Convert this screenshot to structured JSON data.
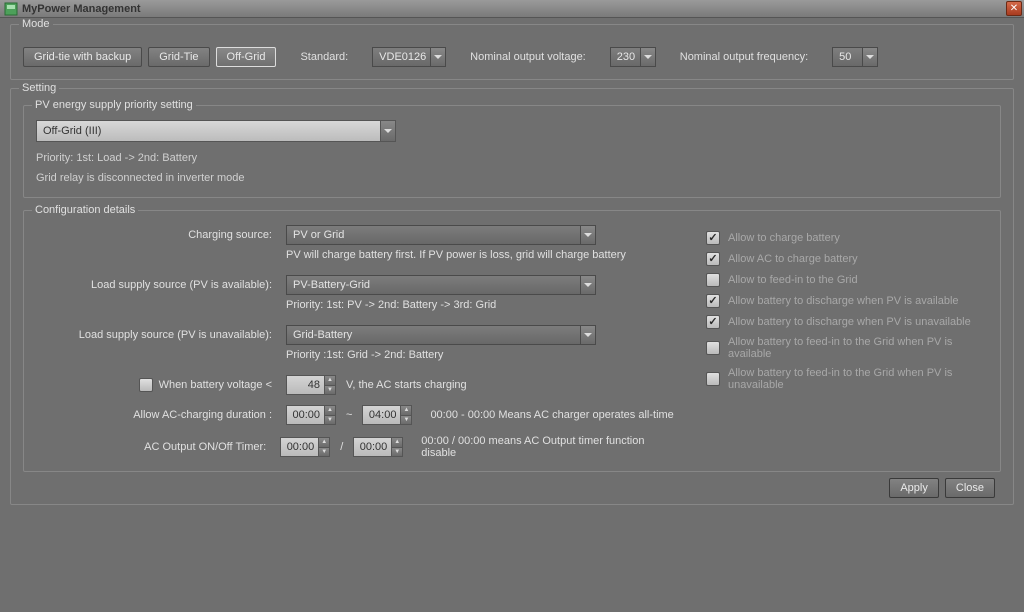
{
  "window": {
    "title": "MyPower Management"
  },
  "mode": {
    "title": "Mode",
    "btn_backup": "Grid-tie with backup",
    "btn_gridtie": "Grid-Tie",
    "btn_offgrid": "Off-Grid",
    "standard_label": "Standard:",
    "standard_value": "VDE0126",
    "voltage_label": "Nominal output voltage:",
    "voltage_value": "230",
    "frequency_label": "Nominal output frequency:",
    "frequency_value": "50"
  },
  "setting": {
    "title": "Setting",
    "pv_priority": {
      "title": "PV energy supply priority setting",
      "value": "Off-Grid (III)",
      "desc1": "Priority: 1st: Load -> 2nd: Battery",
      "desc2": "Grid relay is disconnected in inverter mode"
    },
    "config": {
      "title": "Configuration details",
      "charging_source_label": "Charging source:",
      "charging_source_value": "PV or Grid",
      "charging_source_hint": "PV will charge battery first. If PV power is loss, grid will charge battery",
      "load_pv_avail_label": "Load supply source (PV is available):",
      "load_pv_avail_value": "PV-Battery-Grid",
      "load_pv_avail_hint": "Priority: 1st: PV -> 2nd: Battery -> 3rd: Grid",
      "load_pv_unavail_label": "Load supply source (PV is unavailable):",
      "load_pv_unavail_value": "Grid-Battery",
      "load_pv_unavail_hint": "Priority :1st: Grid -> 2nd: Battery",
      "battery_voltage_prefix": "When battery voltage <",
      "battery_voltage_value": "48",
      "battery_voltage_suffix": "V,    the AC starts charging",
      "ac_duration_label": "Allow AC-charging duration :",
      "ac_duration_from": "00:00",
      "ac_duration_sep": "~",
      "ac_duration_to": "04:00",
      "ac_duration_hint": "00:00 - 00:00 Means AC charger operates all-time",
      "ac_timer_label": "AC Output ON/Off Timer:",
      "ac_timer_from": "00:00",
      "ac_timer_sep": "/",
      "ac_timer_to": "00:00",
      "ac_timer_hint": "00:00 / 00:00 means AC Output timer function disable"
    },
    "checks": {
      "c1": "Allow to charge battery",
      "c2": "Allow AC to charge battery",
      "c3": "Allow to feed-in to the Grid",
      "c4": "Allow battery to discharge when PV is available",
      "c5": "Allow battery to discharge when PV is unavailable",
      "c6": "Allow battery to feed-in to the Grid when PV is available",
      "c7": "Allow battery to feed-in to the Grid when PV is unavailable"
    }
  },
  "footer": {
    "apply": "Apply",
    "close": "Close"
  }
}
